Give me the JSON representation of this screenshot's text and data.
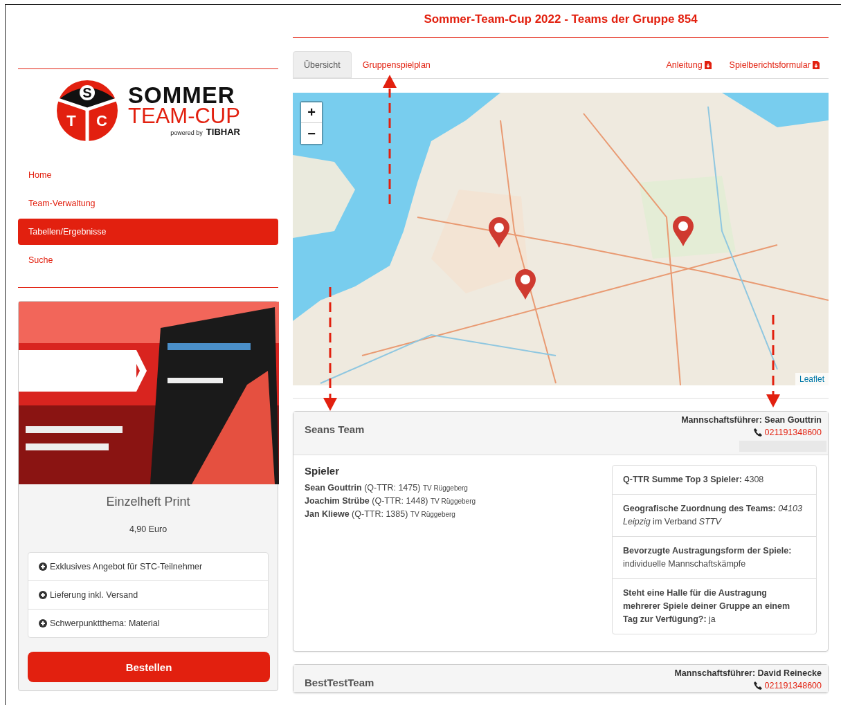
{
  "page_title": "Sommer-Team-Cup 2022 - Teams der Gruppe 854",
  "logo": {
    "letters": [
      "S",
      "T",
      "C"
    ],
    "line_1": "SOMMER",
    "line_2": "TEAM-CUP",
    "powered": "powered by",
    "brand": "TIBHAR"
  },
  "nav": [
    {
      "label": "Home",
      "selected": false
    },
    {
      "label": "Team-Verwaltung",
      "selected": false
    },
    {
      "label": "Tabellen/Ergebnisse",
      "selected": true
    },
    {
      "label": "Suche",
      "selected": false
    }
  ],
  "ad": {
    "title": "Einzelheft Print",
    "price": "4,90 Euro",
    "features": [
      "Exklusives Angebot für STC-Teilnehmer",
      "Lieferung inkl. Versand",
      "Schwerpunktthema: Material"
    ],
    "button": "Bestellen"
  },
  "tabs": [
    {
      "label": "Übersicht",
      "selected": true
    },
    {
      "label": "Gruppenspielplan",
      "selected": false
    }
  ],
  "downloads": [
    "Anleitung",
    "Spielberichtsformular"
  ],
  "map": {
    "zoom_in": "+",
    "zoom_out": "−",
    "attribution": "Leaflet"
  },
  "teams": [
    {
      "name": "Seans Team",
      "captain": "Mannschaftsführer: Sean Gouttrin",
      "phone": "021191348600",
      "players_heading": "Spieler",
      "players": [
        {
          "text": "**Sean Gouttrin** (Q-TTR: 1475)",
          "club": "TV Rüggeberg"
        },
        {
          "text": "**Joachim Strübe** (Q-TTR: 1448)",
          "club": "TV Rüggeberg"
        },
        {
          "text": "**Jan Kliewe** (Q-TTR: 1385)",
          "club": "TV Rüggeberg"
        }
      ],
      "info": [
        "**Q-TTR Summe Top 3 Spieler:** 4308",
        "**Geografische Zuordnung des Teams:** *04103 Leipzig* im Verband *STTV*",
        "**Bevorzugte Austragungsform der Spiele:** individuelle Mannschaftskämpfe",
        "**Steht eine Halle für die Austragung mehrerer Spiele deiner Gruppe an einem Tag zur Verfügung?:** ja"
      ]
    },
    {
      "name": "BestTestTeam",
      "captain": "Mannschaftsführer: David Reinecke",
      "phone": "021191348600"
    }
  ]
}
